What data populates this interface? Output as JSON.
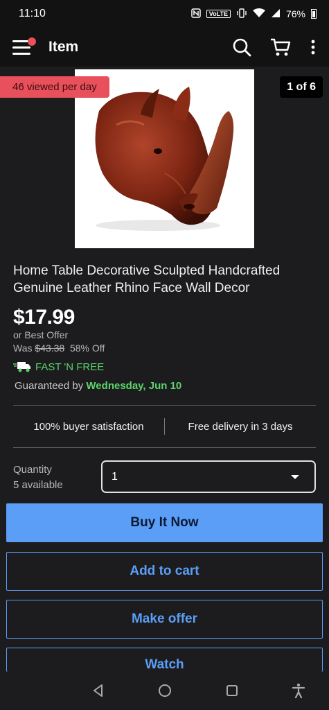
{
  "status_bar": {
    "time": "11:10",
    "network_label": "VoLTE",
    "battery": "76%"
  },
  "app_bar": {
    "title": "Item",
    "icons": [
      "menu-icon",
      "search-icon",
      "cart-icon",
      "more-vert-icon"
    ]
  },
  "gallery": {
    "viewed_badge": "46 viewed per day",
    "counter": "1 of 6",
    "image_subject": "leather rhino head"
  },
  "product": {
    "title": "Home Table Decorative Sculpted Handcrafted Genuine Leather Rhino Face Wall Decor",
    "price": "$17.99",
    "best_offer": "or Best Offer",
    "was_label": "Was",
    "was_price": "$43.38",
    "discount": "58% Off",
    "shipping": "FAST 'N FREE",
    "guaranteed_label": "Guaranteed by",
    "guaranteed_date": "Wednesday, Jun 10"
  },
  "benefits": {
    "left": "100% buyer satisfaction",
    "right": "Free delivery in 3 days"
  },
  "quantity": {
    "label": "Quantity",
    "available": "5 available",
    "selected": "1"
  },
  "actions": {
    "buy_now": "Buy It Now",
    "add_to_cart": "Add to cart",
    "make_offer": "Make offer",
    "watch": "Watch"
  },
  "colors": {
    "accent_blue": "#5b9ef7",
    "badge_red": "#e8505b",
    "shipping_green": "#5bd46a",
    "background": "#1c1c1e"
  }
}
